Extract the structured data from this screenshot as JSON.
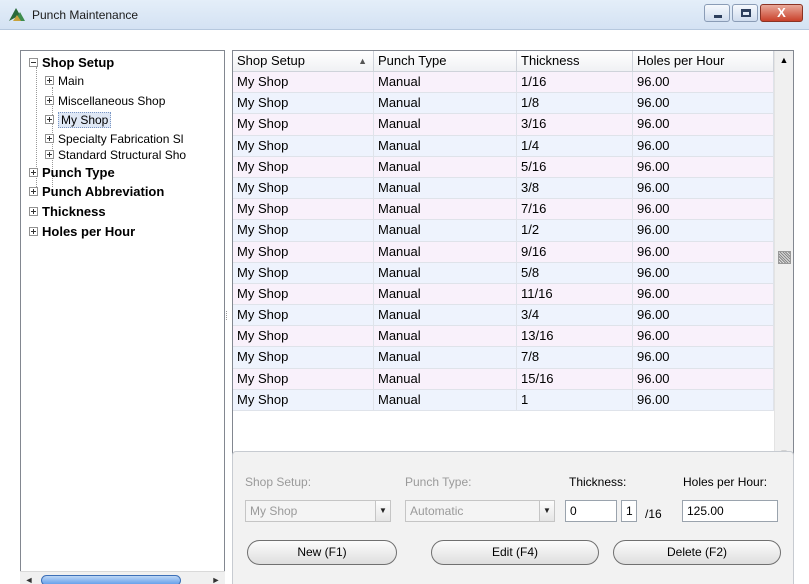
{
  "window": {
    "title": "Punch Maintenance",
    "close_glyph": "X"
  },
  "tree": {
    "root_label": "Shop Setup",
    "shops": [
      "Main",
      "Miscellaneous Shop",
      "My Shop",
      "Specialty Fabrication Sl",
      "Standard Structural Sho"
    ],
    "selected_shop": "My Shop",
    "categories": [
      "Punch Type",
      "Punch Abbreviation",
      "Thickness",
      "Holes per Hour"
    ]
  },
  "grid": {
    "columns": [
      "Shop Setup",
      "Punch Type",
      "Thickness",
      "Holes per Hour"
    ],
    "sort_indicator": "▲",
    "rows": [
      [
        "My Shop",
        "Manual",
        "1/16",
        "96.00"
      ],
      [
        "My Shop",
        "Manual",
        "1/8",
        "96.00"
      ],
      [
        "My Shop",
        "Manual",
        "3/16",
        "96.00"
      ],
      [
        "My Shop",
        "Manual",
        "1/4",
        "96.00"
      ],
      [
        "My Shop",
        "Manual",
        "5/16",
        "96.00"
      ],
      [
        "My Shop",
        "Manual",
        "3/8",
        "96.00"
      ],
      [
        "My Shop",
        "Manual",
        "7/16",
        "96.00"
      ],
      [
        "My Shop",
        "Manual",
        "1/2",
        "96.00"
      ],
      [
        "My Shop",
        "Manual",
        "9/16",
        "96.00"
      ],
      [
        "My Shop",
        "Manual",
        "5/8",
        "96.00"
      ],
      [
        "My Shop",
        "Manual",
        "11/16",
        "96.00"
      ],
      [
        "My Shop",
        "Manual",
        "3/4",
        "96.00"
      ],
      [
        "My Shop",
        "Manual",
        "13/16",
        "96.00"
      ],
      [
        "My Shop",
        "Manual",
        "7/8",
        "96.00"
      ],
      [
        "My Shop",
        "Manual",
        "15/16",
        "96.00"
      ],
      [
        "My Shop",
        "Manual",
        "1",
        "96.00"
      ]
    ]
  },
  "form": {
    "shop_setup_label": "Shop Setup:",
    "shop_setup_value": "My Shop",
    "punch_type_label": "Punch Type:",
    "punch_type_value": "Automatic",
    "thickness_label": "Thickness:",
    "thickness_whole": "0",
    "thickness_numerator": "1",
    "thickness_denominator": "/16",
    "holes_label": "Holes per Hour:",
    "holes_value": "125.00"
  },
  "buttons": {
    "new": "New (F1)",
    "edit": "Edit (F4)",
    "delete": "Delete (F2)"
  },
  "glyphs": {
    "dropdown": "▼",
    "up": "▲",
    "down": "▼",
    "left": "◄",
    "right": "►"
  }
}
